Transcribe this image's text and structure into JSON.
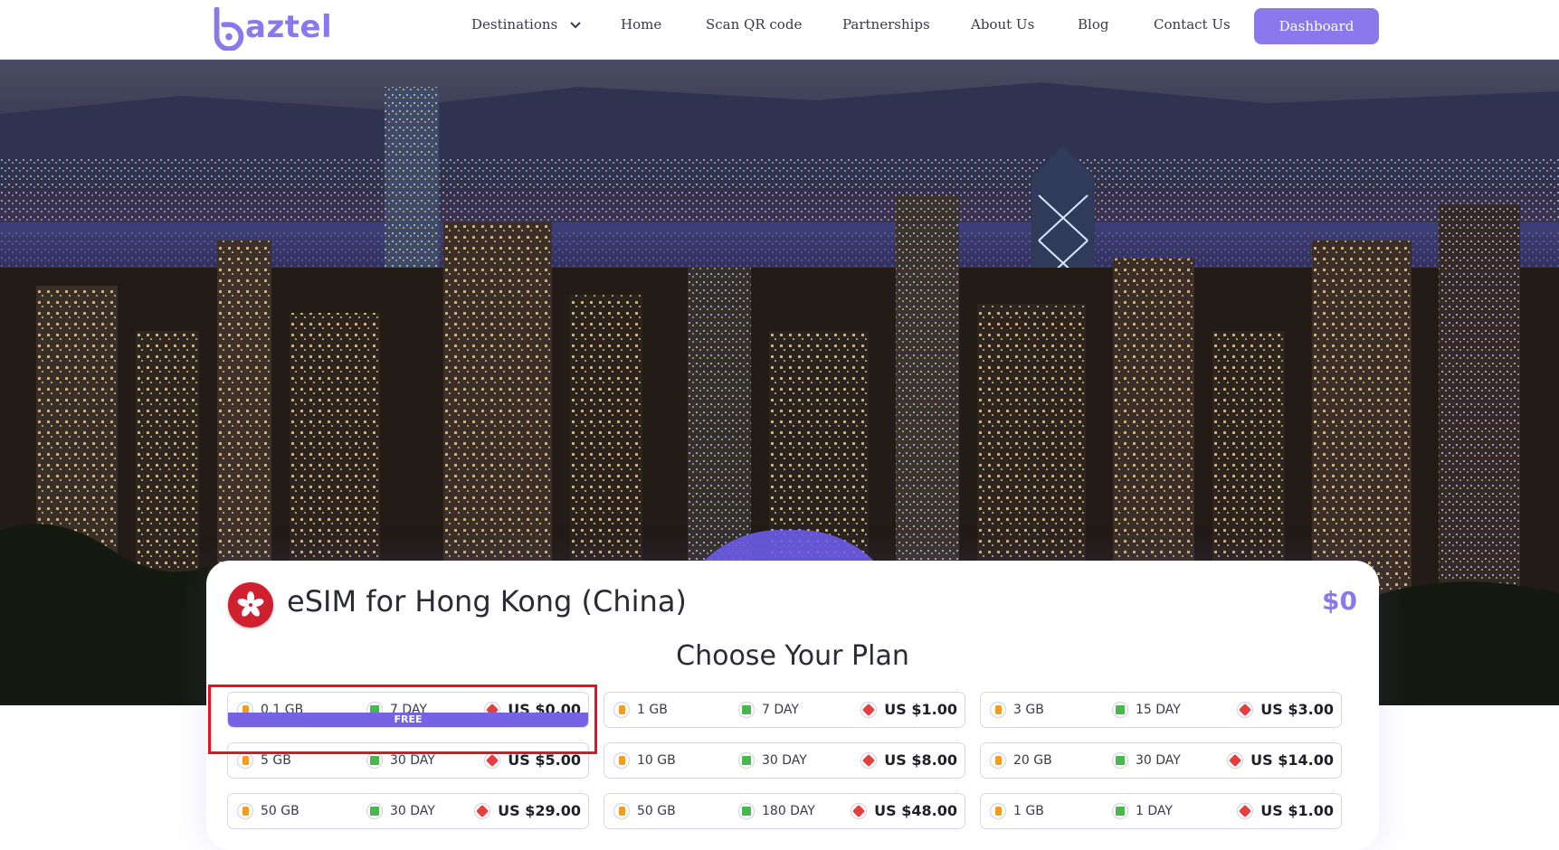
{
  "brand": {
    "name": "aztel",
    "accent": "#8b78ec"
  },
  "nav": {
    "destinations": "Destinations",
    "home": "Home",
    "scan": "Scan QR code",
    "partnerships": "Partnerships",
    "about": "About Us",
    "blog": "Blog",
    "contact": "Contact Us",
    "dashboard": "Dashboard"
  },
  "card": {
    "title": "eSIM for Hong Kong (China)",
    "total": "$0",
    "choose": "Choose Your Plan",
    "flag_icon": "hong-kong-flag-icon"
  },
  "plans": [
    {
      "data": "0.1 GB",
      "days": "7 DAY",
      "price": "US $0.00",
      "badge": "FREE"
    },
    {
      "data": "1 GB",
      "days": "7 DAY",
      "price": "US $1.00"
    },
    {
      "data": "3 GB",
      "days": "15 DAY",
      "price": "US $3.00"
    },
    {
      "data": "5 GB",
      "days": "30 DAY",
      "price": "US $5.00"
    },
    {
      "data": "10 GB",
      "days": "30 DAY",
      "price": "US $8.00"
    },
    {
      "data": "20 GB",
      "days": "30 DAY",
      "price": "US $14.00"
    },
    {
      "data": "50 GB",
      "days": "30 DAY",
      "price": "US $29.00"
    },
    {
      "data": "50 GB",
      "days": "180 DAY",
      "price": "US $48.00"
    },
    {
      "data": "1 GB",
      "days": "1 DAY",
      "price": "US $1.00"
    }
  ]
}
